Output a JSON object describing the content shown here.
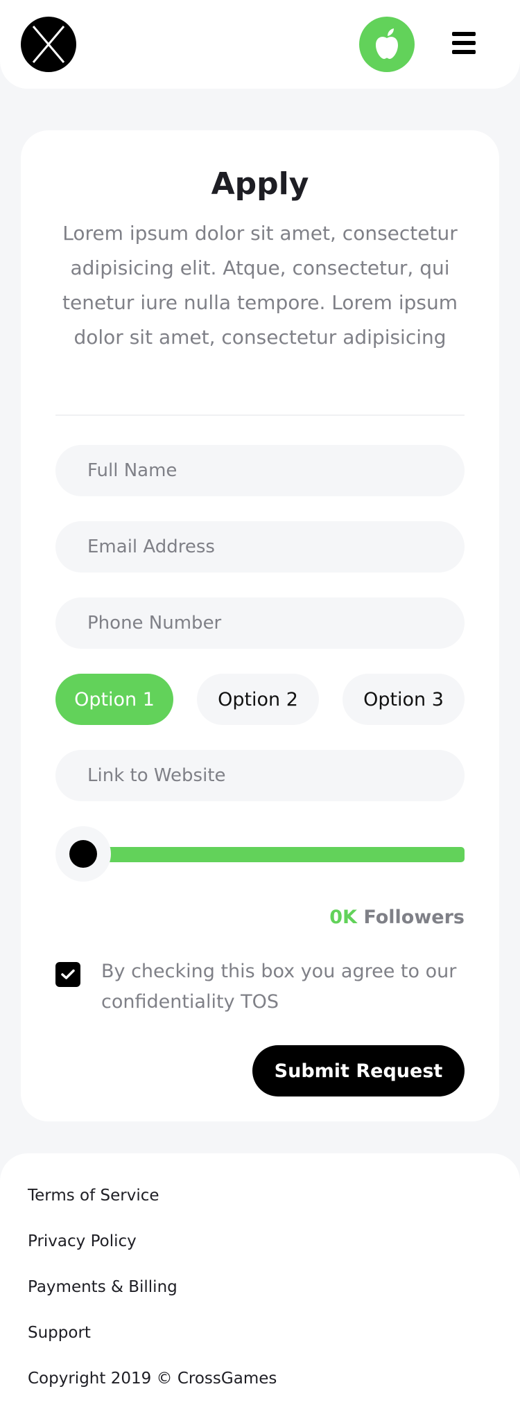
{
  "header": {
    "logo_icon": "cross-logo-icon",
    "apple_icon": "apple-icon",
    "menu_icon": "hamburger-menu-icon",
    "accent_color": "#62d25a"
  },
  "form": {
    "title": "Apply",
    "description": "Lorem ipsum dolor sit amet, consectetur adipisicing elit. Atque, consectetur, qui tenetur iure nulla tempore. Lorem ipsum dolor sit amet, consectetur adipisicing",
    "full_name_placeholder": "Full Name",
    "email_placeholder": "Email Address",
    "phone_placeholder": "Phone Number",
    "options": [
      {
        "label": "Option 1",
        "selected": true
      },
      {
        "label": "Option 2",
        "selected": false
      },
      {
        "label": "Option 3",
        "selected": false
      }
    ],
    "website_placeholder": "Link to Website",
    "slider_value": 0,
    "followers_count": "0K",
    "followers_label": "Followers",
    "checkbox_checked": true,
    "checkbox_text": "By checking this box you agree to our confidentiality TOS",
    "submit_label": "Submit Request"
  },
  "footer": {
    "links": [
      "Terms of Service",
      "Privacy Policy",
      "Payments & Billing",
      "Support"
    ],
    "copyright": "Copyright 2019 © CrossGames"
  }
}
